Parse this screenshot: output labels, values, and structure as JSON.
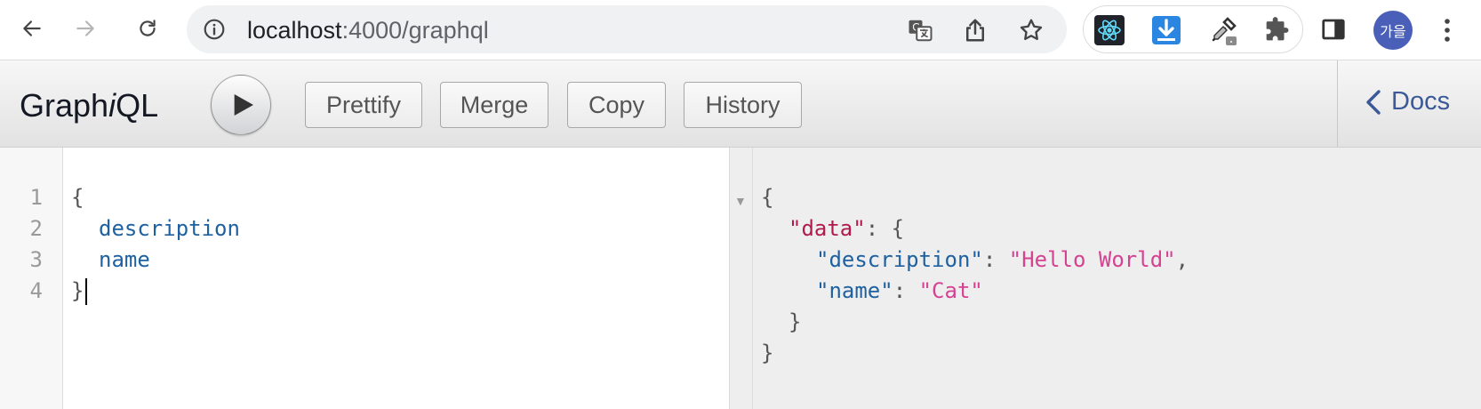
{
  "browser": {
    "url_host": "localhost",
    "url_path": ":4000/graphql",
    "profile_initials": "가을",
    "icons": {
      "back": "back-arrow-icon",
      "forward": "forward-arrow-icon",
      "reload": "reload-icon",
      "site_info": "info-icon",
      "translate": "translate-icon",
      "share": "share-icon",
      "bookmark": "star-icon",
      "extensions": [
        "react-devtools-icon",
        "download-icon",
        "eyedropper-icon",
        "puzzle-icon"
      ],
      "side_panel": "side-panel-icon",
      "menu": "kebab-menu-icon"
    }
  },
  "graphiql": {
    "logo_prefix": "Graph",
    "logo_italic": "i",
    "logo_suffix": "QL",
    "buttons": {
      "prettify": "Prettify",
      "merge": "Merge",
      "copy": "Copy",
      "history": "History"
    },
    "docs_label": "Docs",
    "query": {
      "line_numbers": [
        "1",
        "2",
        "3",
        "4"
      ],
      "lines": [
        "{",
        "description",
        "name",
        "}"
      ]
    },
    "result": {
      "open_brace": "{",
      "data_key": "\"data\"",
      "desc_key": "\"description\"",
      "desc_value": "\"Hello World\"",
      "name_key": "\"name\"",
      "name_value": "\"Cat\"",
      "inner_close": "}",
      "outer_close": "}"
    }
  },
  "colors": {
    "field": "#1f61a0",
    "result_key": "#1f61a0",
    "data_key": "#b11a4d",
    "string": "#d64292",
    "docs_link": "#3b5998"
  }
}
